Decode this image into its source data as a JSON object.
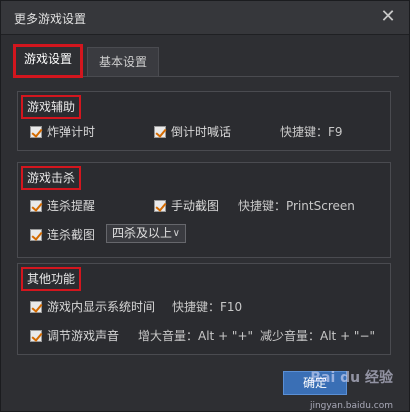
{
  "window": {
    "title": "更多游戏设置"
  },
  "tabs": [
    {
      "label": "游戏设置",
      "active": true
    },
    {
      "label": "基本设置",
      "active": false
    }
  ],
  "groups": {
    "assist": {
      "title": "游戏辅助",
      "items": [
        {
          "label": "炸弹计时",
          "checked": true
        },
        {
          "label": "倒计时喊话",
          "checked": true
        }
      ],
      "shortcut": "快捷键：F9"
    },
    "kill": {
      "title": "游戏击杀",
      "items": [
        {
          "label": "连杀提醒",
          "checked": true
        },
        {
          "label": "手动截图",
          "checked": true
        },
        {
          "label": "连杀截图",
          "checked": true
        }
      ],
      "shortcut": "快捷键：PrintScreen",
      "dropdown": {
        "selected": "四杀及以上"
      }
    },
    "other": {
      "title": "其他功能",
      "items": [
        {
          "label": "游戏内显示系统时间",
          "checked": true
        },
        {
          "label": "调节游戏声音",
          "checked": true
        }
      ],
      "shortcut_time": "快捷键：F10",
      "volume_up": "增大音量：Alt + \"+\"",
      "volume_down": "减少音量：Alt + \"−\""
    }
  },
  "footer": {
    "button_label": "确定",
    "watermark": "Bai du 经验",
    "watermark_url": "jingyan.baidu.com"
  },
  "colors": {
    "highlight_red": "#d3161e",
    "check_orange": "#d36a00",
    "bg": "#2e2f33"
  }
}
